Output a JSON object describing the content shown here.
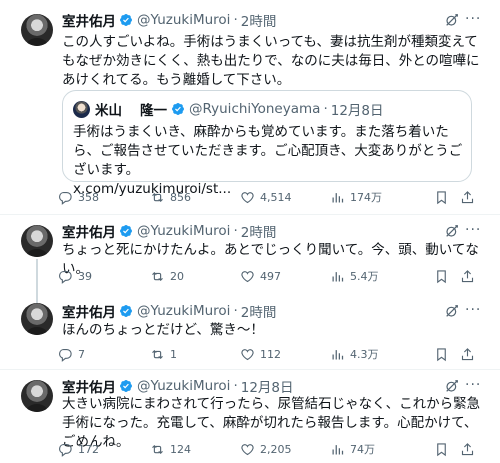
{
  "tweets": [
    {
      "name": "室井佑月",
      "handle": "@YuzukiMuroi",
      "time": "2時間",
      "text": "この人すごいよね。手術はうまくいっても、妻は抗生剤が種類変えてもなぜか効きにくく、熱も出たりで、なのに夫は毎日、外との喧嘩にあけくれてる。もう離婚して下さい。",
      "quote": {
        "name_part1": "米山",
        "name_part2": "隆一",
        "handle": "@RyuichiYoneyama",
        "time": "12月8日",
        "text": "手術はうまくいき、麻酔からも覚めています。また落ち着いたら、ご報告させていただきます。ご心配頂き、大変ありがとうございます。\nx.com/yuzukimuroi/st..."
      },
      "replies": "358",
      "retweets": "856",
      "likes": "4,514",
      "views": "174万"
    },
    {
      "name": "室井佑月",
      "handle": "@YuzukiMuroi",
      "time": "2時間",
      "text": "ちょっと死にかけたんよ。あとでじっくり聞いて。今、頭、動いてない。",
      "replies": "39",
      "retweets": "20",
      "likes": "497",
      "views": "5.4万"
    },
    {
      "name": "室井佑月",
      "handle": "@YuzukiMuroi",
      "time": "2時間",
      "text": "ほんのちょっとだけど、驚き〜！",
      "replies": "7",
      "retweets": "1",
      "likes": "112",
      "views": "4.3万"
    },
    {
      "name": "室井佑月",
      "handle": "@YuzukiMuroi",
      "time": "12月8日",
      "text": "大きい病院にまわされて行ったら、尿管結石じゃなく、これから緊急手術になった。充電して、麻酔が切れたら報告します。心配かけて、ごめんね。",
      "replies": "172",
      "retweets": "124",
      "likes": "2,205",
      "views": "74万"
    }
  ],
  "ui": {
    "separator": "·",
    "more": "···"
  },
  "colors": {
    "verified": "#1d9bf0",
    "text": "#0f1419",
    "secondary": "#536471",
    "border": "#cfd9de"
  },
  "icons": [
    "verified-badge-icon",
    "grok-icon",
    "more-icon",
    "reply-icon",
    "retweet-icon",
    "like-icon",
    "views-icon",
    "bookmark-icon",
    "share-icon"
  ]
}
